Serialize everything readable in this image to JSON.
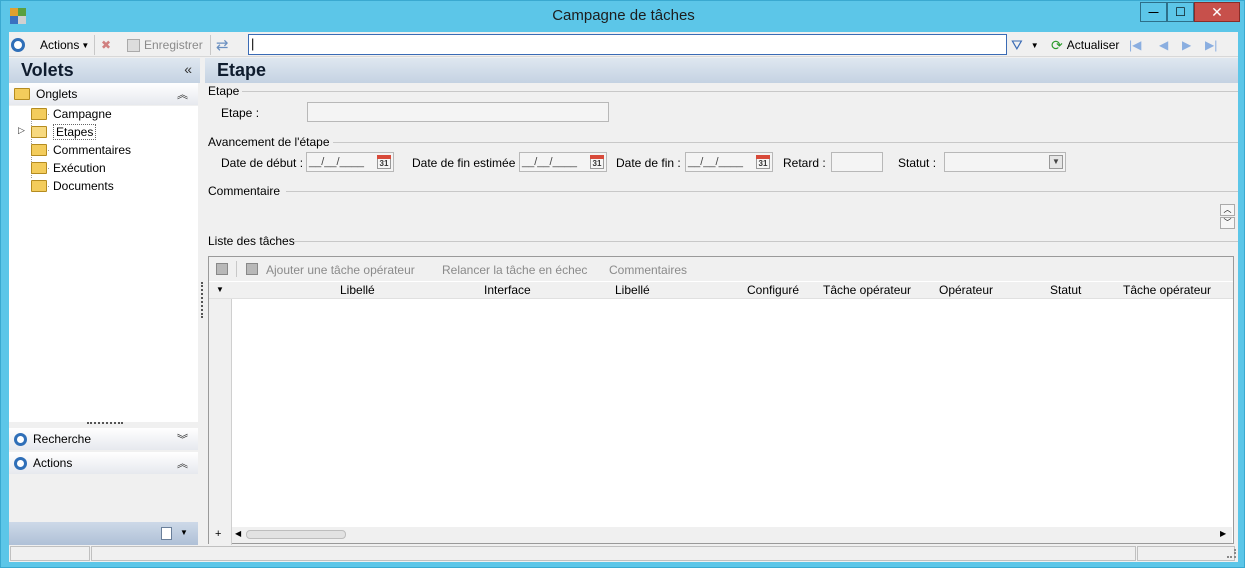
{
  "window": {
    "title": "Campagne de tâches",
    "minimize": "—",
    "maximize": "☐",
    "close": "✕"
  },
  "toolbar": {
    "actions_label": "Actions",
    "enregistrer_label": "Enregistrer",
    "search_value": "|",
    "actualiser_label": "Actualiser"
  },
  "sidebar": {
    "title": "Volets",
    "collapse": "«",
    "onglets_label": "Onglets",
    "tree": [
      {
        "label": "Campagne"
      },
      {
        "label": "Etapes"
      },
      {
        "label": "Commentaires"
      },
      {
        "label": "Exécution"
      },
      {
        "label": "Documents"
      }
    ],
    "recherche_label": "Recherche",
    "actions_label": "Actions"
  },
  "main": {
    "title": "Etape",
    "etape_section": "Etape",
    "etape_label": "Etape :",
    "avancement_section": "Avancement de l'étape",
    "date_debut_label": "Date de début :",
    "date_placeholder": "__/__/____",
    "date_fin_estimee_label": "Date de fin estimée :",
    "date_fin_label": "Date de fin :",
    "retard_label": "Retard :",
    "statut_label": "Statut :",
    "calendar_day": "31",
    "commentaire_section": "Commentaire",
    "liste_section": "Liste des tâches",
    "grid_toolbar": {
      "ajouter": "Ajouter une tâche opérateur",
      "relancer": "Relancer la tâche en échec",
      "commentaires": "Commentaires"
    },
    "columns": [
      "Libellé",
      "Interface",
      "Libellé",
      "Configuré",
      "Tâche opérateur",
      "Opérateur",
      "Statut",
      "Tâche opérateur"
    ]
  }
}
